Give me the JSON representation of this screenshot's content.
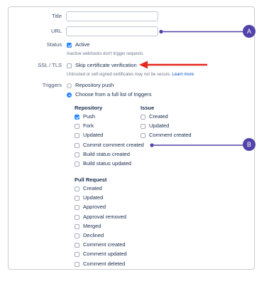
{
  "form": {
    "title_label": "Title",
    "url_label": "URL",
    "status_label": "Status",
    "active_label": "Active",
    "active_checked": true,
    "active_help": "Inactive webhooks don't trigger requests.",
    "ssl_label": "SSL / TLS",
    "skip_cert_label": "Skip certificate verification",
    "skip_cert_checked": false,
    "ssl_help": "Untrusted or self-signed certificates may not be secure.",
    "learn_more": "Learn more",
    "triggers_label": "Triggers",
    "repo_push_option": "Repository push",
    "full_list_option": "Choose from a full list of triggers",
    "selected_trigger_mode": "full_list"
  },
  "repository": {
    "heading": "Repository",
    "items": [
      {
        "label": "Push",
        "checked": true
      },
      {
        "label": "Fork",
        "checked": false
      },
      {
        "label": "Updated",
        "checked": false
      },
      {
        "label": "Commit comment created",
        "checked": false
      },
      {
        "label": "Build status created",
        "checked": false
      },
      {
        "label": "Build status updated",
        "checked": false
      }
    ]
  },
  "issue": {
    "heading": "Issue",
    "items": [
      {
        "label": "Created",
        "checked": false
      },
      {
        "label": "Updated",
        "checked": false
      },
      {
        "label": "Comment created",
        "checked": false
      }
    ]
  },
  "pull_request": {
    "heading": "Pull Request",
    "items": [
      {
        "label": "Created",
        "checked": false
      },
      {
        "label": "Updated",
        "checked": false
      },
      {
        "label": "Approved",
        "checked": false
      },
      {
        "label": "Approval removed",
        "checked": false
      },
      {
        "label": "Merged",
        "checked": false
      },
      {
        "label": "Declined",
        "checked": false
      },
      {
        "label": "Comment created",
        "checked": false
      },
      {
        "label": "Comment updated",
        "checked": false
      },
      {
        "label": "Comment deleted",
        "checked": false
      }
    ]
  },
  "callouts": {
    "a": "A",
    "b": "B"
  },
  "colors": {
    "accent": "#2684ff",
    "callout": "#5243aa",
    "arrow": "#e5271f"
  }
}
